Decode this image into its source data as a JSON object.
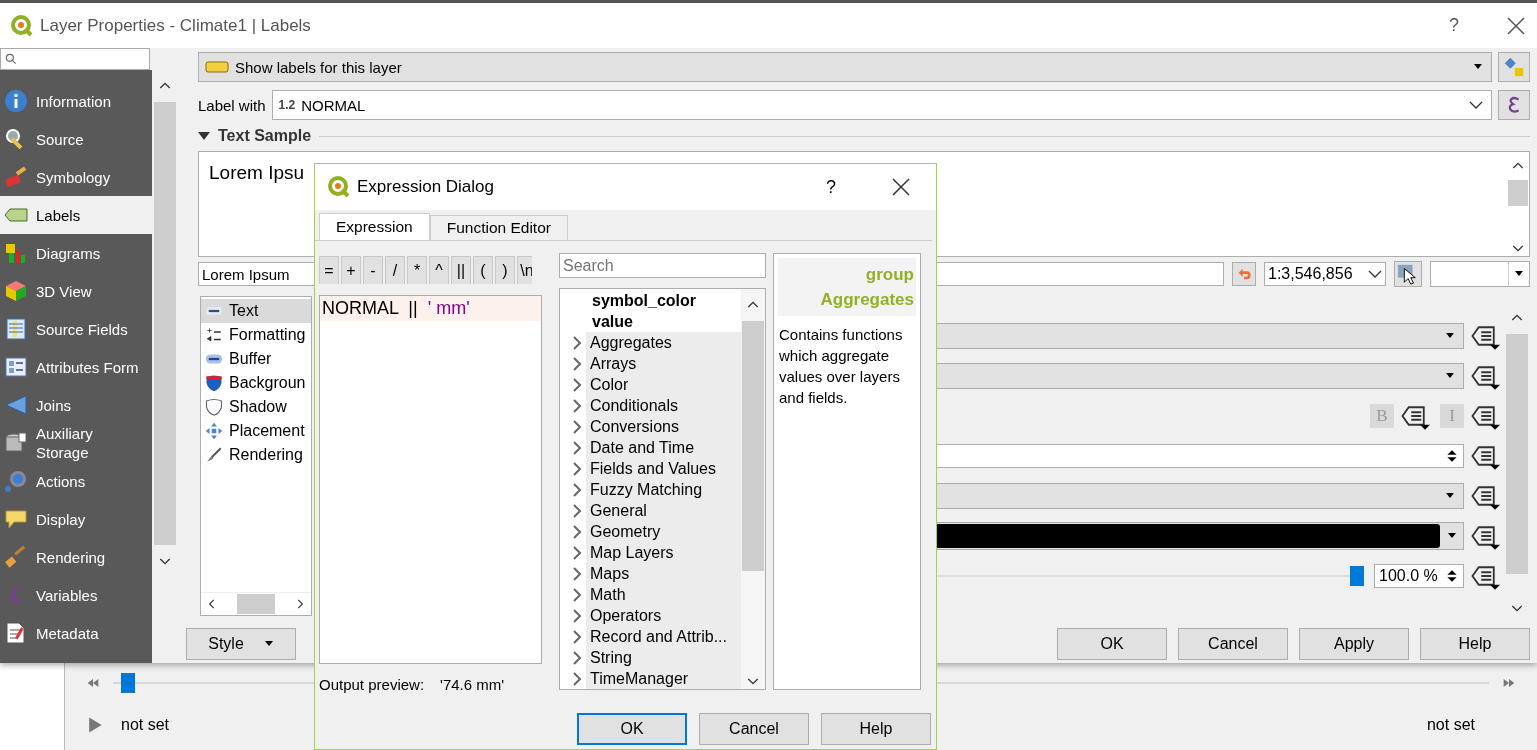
{
  "window": {
    "title": "Layer Properties - Climate1 | Labels",
    "help_label": "?"
  },
  "sidebar": {
    "items": [
      {
        "label": "Information",
        "selected": false
      },
      {
        "label": "Source",
        "selected": false
      },
      {
        "label": "Symbology",
        "selected": false
      },
      {
        "label": "Labels",
        "selected": true
      },
      {
        "label": "Diagrams",
        "selected": false
      },
      {
        "label": "3D View",
        "selected": false
      },
      {
        "label": "Source Fields",
        "selected": false
      },
      {
        "label": "Attributes Form",
        "selected": false
      },
      {
        "label": "Joins",
        "selected": false
      },
      {
        "label": "Auxiliary Storage",
        "selected": false
      },
      {
        "label": "Actions",
        "selected": false
      },
      {
        "label": "Display",
        "selected": false
      },
      {
        "label": "Rendering",
        "selected": false
      },
      {
        "label": "Variables",
        "selected": false
      },
      {
        "label": "Metadata",
        "selected": false
      }
    ]
  },
  "labeling": {
    "mode": "Show labels for this layer",
    "label_with": "Label with",
    "field_type": "1.2",
    "field": "NORMAL",
    "section": {
      "title": "Text Sample",
      "expanded": true
    },
    "sample_text": "Lorem Ipsu",
    "sample_input": "Lorem Ipsum",
    "scale": "1:3,546,856"
  },
  "text_settings": {
    "items": [
      {
        "label": "Text",
        "selected": true
      },
      {
        "label": "Formatting",
        "selected": false
      },
      {
        "label": "Buffer",
        "selected": false
      },
      {
        "label": "Backgroun",
        "selected": false
      },
      {
        "label": "Shadow",
        "selected": false
      },
      {
        "label": "Placement",
        "selected": false
      },
      {
        "label": "Rendering",
        "selected": false
      }
    ],
    "rows": [
      {
        "kind": "dropdown"
      },
      {
        "kind": "dropdown"
      },
      {
        "kind": "style_buttons",
        "bold_label": "B",
        "italic_label": "I"
      },
      {
        "kind": "spinbox"
      },
      {
        "kind": "dropdown"
      },
      {
        "kind": "color",
        "color": "#000000"
      },
      {
        "kind": "slider",
        "level": 1,
        "value": "100.0 %"
      }
    ]
  },
  "style_button": "Style",
  "buttons": [
    "OK",
    "Cancel",
    "Apply",
    "Help"
  ],
  "timeline": {
    "level": 0,
    "start": "not set",
    "end": "not set"
  },
  "expression_dialog": {
    "title": "Expression Dialog",
    "help_label": "?",
    "tabs": [
      {
        "label": "Expression",
        "selected": true
      },
      {
        "label": "Function Editor",
        "selected": false
      }
    ],
    "operators": [
      "=",
      "+",
      "-",
      "/",
      "*",
      "^",
      "||",
      "(",
      ")",
      "\\n"
    ],
    "expression": [
      {
        "text": "NORMAL",
        "kind": "field"
      },
      {
        "text": "||",
        "kind": "operator"
      },
      {
        "text": "' mm'",
        "kind": "string"
      }
    ],
    "output_label": "Output preview:",
    "output_value": "'74.6 mm'",
    "search_placeholder": "Search",
    "functions": [
      {
        "label": "symbol_color",
        "kind": "variable"
      },
      {
        "label": "value",
        "kind": "variable"
      },
      {
        "label": "Aggregates",
        "kind": "group",
        "expanded": false
      },
      {
        "label": "Arrays",
        "kind": "group",
        "expanded": false
      },
      {
        "label": "Color",
        "kind": "group",
        "expanded": false
      },
      {
        "label": "Conditionals",
        "kind": "group",
        "expanded": false
      },
      {
        "label": "Conversions",
        "kind": "group",
        "expanded": false
      },
      {
        "label": "Date and Time",
        "kind": "group",
        "expanded": false
      },
      {
        "label": "Fields and Values",
        "kind": "group",
        "expanded": false
      },
      {
        "label": "Fuzzy Matching",
        "kind": "group",
        "expanded": false
      },
      {
        "label": "General",
        "kind": "group",
        "expanded": false
      },
      {
        "label": "Geometry",
        "kind": "group",
        "expanded": false
      },
      {
        "label": "Map Layers",
        "kind": "group",
        "expanded": false
      },
      {
        "label": "Maps",
        "kind": "group",
        "expanded": false
      },
      {
        "label": "Math",
        "kind": "group",
        "expanded": false
      },
      {
        "label": "Operators",
        "kind": "group",
        "expanded": false
      },
      {
        "label": "Record and Attrib...",
        "kind": "group",
        "expanded": false
      },
      {
        "label": "String",
        "kind": "group",
        "expanded": false
      },
      {
        "label": "TimeManager",
        "kind": "group",
        "expanded": false
      }
    ],
    "help": {
      "kind_label": "group",
      "name": "Aggregates",
      "description": "Contains functions which aggregate values over layers and fields."
    },
    "buttons": [
      {
        "label": "OK",
        "default": true
      },
      {
        "label": "Cancel",
        "default": false
      },
      {
        "label": "Help",
        "default": false
      }
    ]
  }
}
